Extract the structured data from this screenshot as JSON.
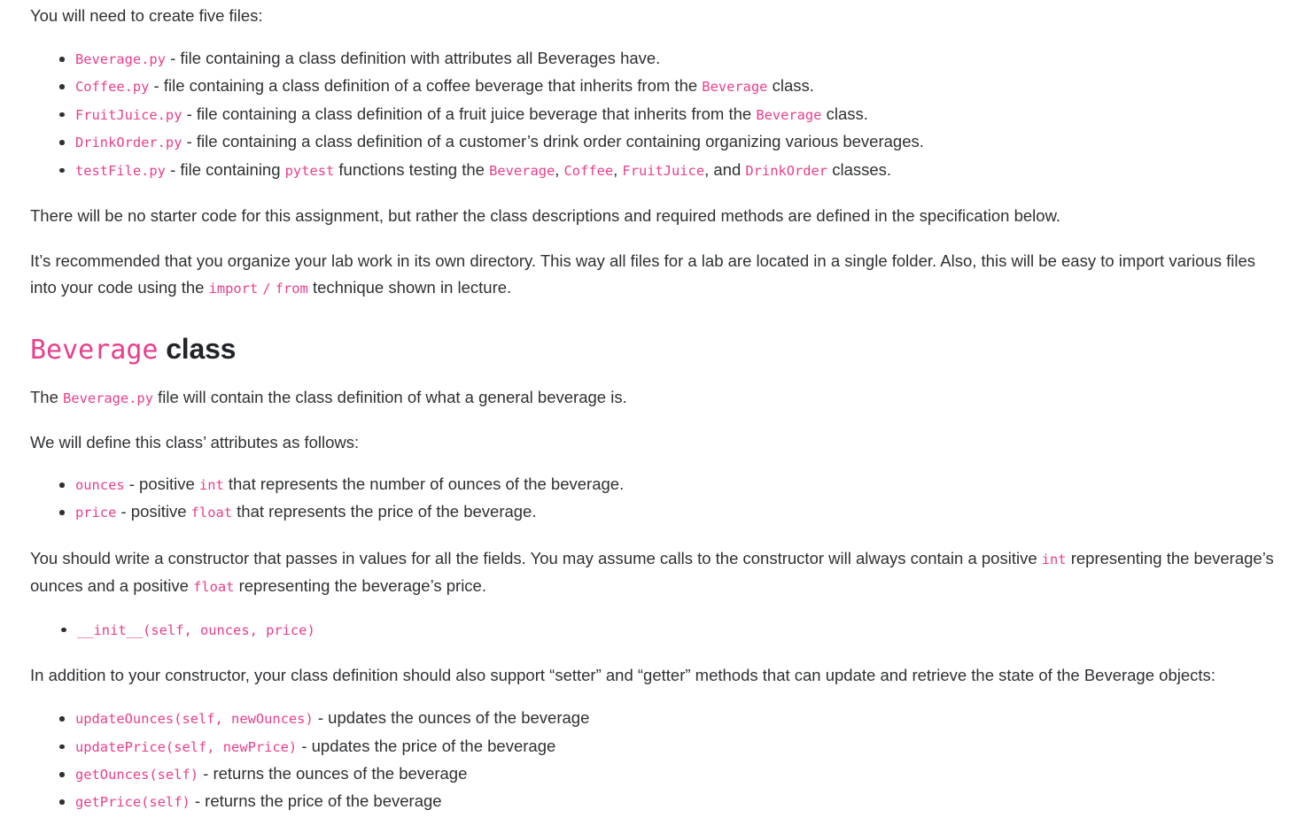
{
  "theme": {
    "code_color": "#e83e8c",
    "text_color": "#2e3033",
    "heading_color": "#212529",
    "background": "#ffffff"
  },
  "document": {
    "intro": "You will need to create five files:",
    "files_list": [
      {
        "code": "Beverage.py",
        "after": " - file containing a class definition with attributes all Beverages have."
      },
      {
        "code": "Coffee.py",
        "after": " - file containing a class definition of a coffee beverage that inherits from the ",
        "code2": "Beverage",
        "after2": " class."
      },
      {
        "code": "FruitJuice.py",
        "after": " - file containing a class definition of a fruit juice beverage that inherits from the ",
        "code2": "Beverage",
        "after2": " class."
      },
      {
        "code": "DrinkOrder.py",
        "after": " - file containing a class definition of a customer’s drink order containing organizing various beverages."
      },
      {
        "code": "testFile.py",
        "after": " - file containing ",
        "code2": "pytest",
        "after2": " functions testing the ",
        "code3": "Beverage",
        "after3": ", ",
        "code4": "Coffee",
        "after4": ", ",
        "code5": "FruitJuice",
        "after5": ", and ",
        "code6": "DrinkOrder",
        "after6": " classes."
      }
    ],
    "no_starter_code": "There will be no starter code for this assignment, but rather the class descriptions and required methods are defined in the specification below.",
    "recommended": {
      "part1": "It’s recommended that you organize your lab work in its own directory. This way all files for a lab are located in a single folder. Also, this will be easy to import various files into your code using the ",
      "code1": "import",
      "middle": " ",
      "code2": "/",
      "middle2": " ",
      "code3": "from",
      "part2": " technique shown in lecture."
    },
    "heading": {
      "code": "Beverage",
      "plain": "class"
    },
    "file_contains": {
      "before": "The ",
      "code": "Beverage.py",
      "after": " file will contain the class definition of what a general beverage is."
    },
    "attributes_intro": "We will define this class’ attributes as follows:",
    "attributes": [
      {
        "code": "ounces",
        "after": " - positive ",
        "code2": "int",
        "after2": " that represents the number of ounces of the beverage."
      },
      {
        "code": "price",
        "after": " - positive ",
        "code2": "float",
        "after2": " that represents the price of the beverage."
      }
    ],
    "constructor_para": {
      "part1": "You should write a constructor that passes in values for all the fields. You may assume calls to the constructor will always contain a positive ",
      "code1": "int",
      "part2": " representing the beverage’s ounces and a positive ",
      "code2": "float",
      "part3": " representing the beverage’s price."
    },
    "constructor_list": [
      {
        "code": "__init__(self, ounces, price)"
      }
    ],
    "setter_getter_para": "In addition to your constructor, your class definition should also support “setter” and “getter” methods that can update and retrieve the state of the Beverage objects:",
    "methods": [
      {
        "code": "updateOunces(self, newOunces)",
        "after": " - updates the ounces of the beverage"
      },
      {
        "code": "updatePrice(self, newPrice)",
        "after": " - updates the price of the beverage"
      },
      {
        "code": "getOunces(self)",
        "after": " - returns the ounces of the beverage"
      },
      {
        "code": "getPrice(self)",
        "after": " - returns the price of the beverage"
      }
    ]
  }
}
